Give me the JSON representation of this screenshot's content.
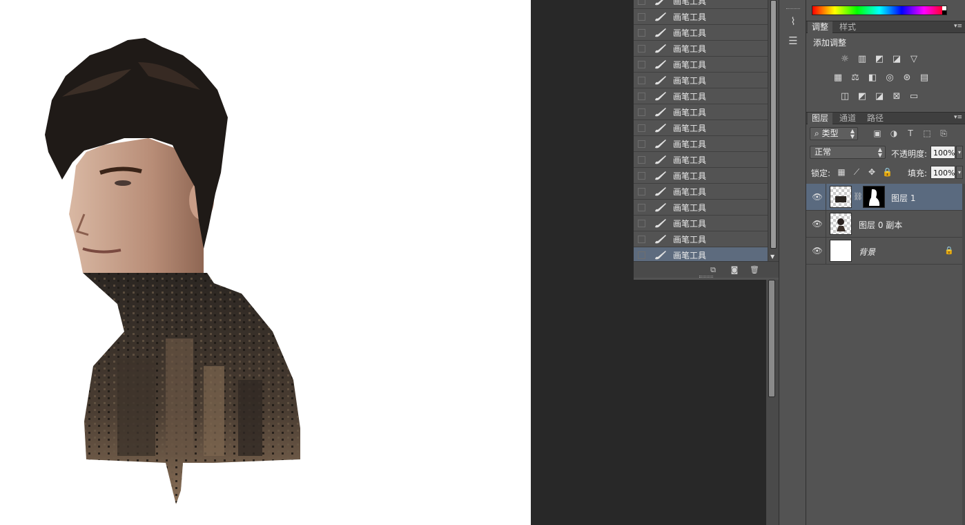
{
  "canvas": {
    "background": "#ffffff"
  },
  "history": {
    "items": [
      {
        "label": "画笔工具"
      },
      {
        "label": "画笔工具"
      },
      {
        "label": "画笔工具"
      },
      {
        "label": "画笔工具"
      },
      {
        "label": "画笔工具"
      },
      {
        "label": "画笔工具"
      },
      {
        "label": "画笔工具"
      },
      {
        "label": "画笔工具"
      },
      {
        "label": "画笔工具"
      },
      {
        "label": "画笔工具"
      },
      {
        "label": "画笔工具"
      },
      {
        "label": "画笔工具"
      },
      {
        "label": "画笔工具"
      },
      {
        "label": "画笔工具"
      },
      {
        "label": "画笔工具"
      },
      {
        "label": "画笔工具"
      },
      {
        "label": "画笔工具"
      }
    ],
    "selected_index": 16,
    "footer_icons": [
      "new-document-from-state-icon",
      "camera-snapshot-icon",
      "trash-icon"
    ]
  },
  "dock": {
    "icons": [
      "brush-presets-icon",
      "properties-sliders-icon"
    ]
  },
  "adjustments": {
    "tabs": [
      {
        "label": "调整"
      },
      {
        "label": "样式"
      }
    ],
    "title": "添加调整",
    "icons": [
      "brightness-icon",
      "levels-icon",
      "curves-icon",
      "exposure-icon",
      "vibrance-icon",
      "hue-saturation-icon",
      "color-balance-icon",
      "black-white-icon",
      "photo-filter-icon",
      "channel-mixer-icon",
      "color-lookup-icon",
      "invert-icon",
      "posterize-icon",
      "threshold-icon",
      "selective-color-icon",
      "gradient-map-icon"
    ]
  },
  "layers_panel": {
    "tabs": [
      {
        "label": "图层"
      },
      {
        "label": "通道"
      },
      {
        "label": "路径"
      }
    ],
    "filter": {
      "label": "类型"
    },
    "blend_mode": "正常",
    "opacity_label": "不透明度:",
    "opacity_value": "100%",
    "lock_label": "锁定:",
    "fill_label": "填充:",
    "fill_value": "100%",
    "layers": [
      {
        "name": "图层 1",
        "selected": true,
        "has_mask": true
      },
      {
        "name": "图层 0 副本",
        "selected": false,
        "has_mask": false
      },
      {
        "name": "背景",
        "selected": false,
        "locked": true
      }
    ]
  },
  "colors": {
    "panel": "#535353",
    "selected_row": "#5d6b7e",
    "dark_bg": "#282828"
  }
}
